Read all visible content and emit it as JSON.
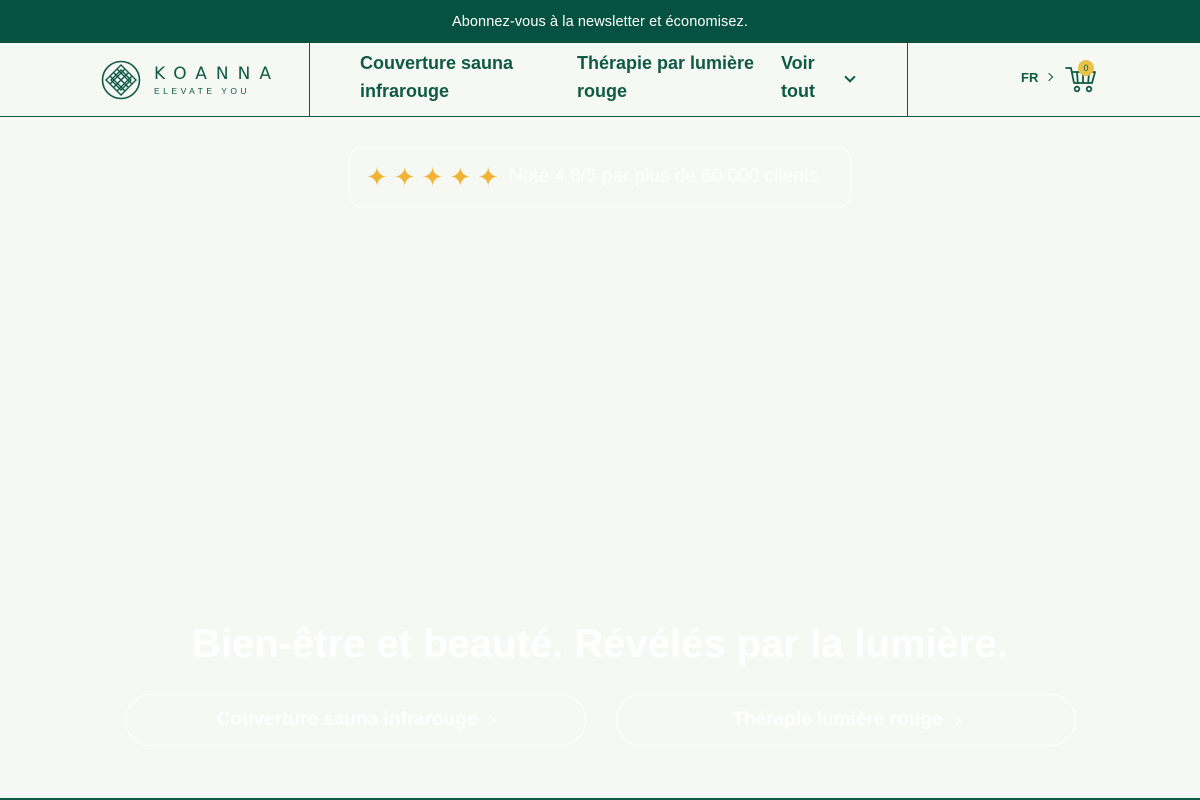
{
  "announcement": {
    "text": "Abonnez-vous à la newsletter et économisez."
  },
  "brand": {
    "name": "KOANNA",
    "tagline": "ELEVATE YOU",
    "logo_icon": "lattice-diamond-icon"
  },
  "nav": {
    "items": [
      {
        "label_line1": "Couverture sauna",
        "label_line2": "infrarouge"
      },
      {
        "label_line1": "Thérapie par lumière",
        "label_line2": "rouge"
      },
      {
        "label_line1": "Voir",
        "label_line2": "tout"
      }
    ]
  },
  "header_tools": {
    "language": "FR",
    "cart_count": "0",
    "cart_icon": "cart-icon"
  },
  "hero": {
    "rating_stars": 5,
    "rating_text": "Noté 4.8/5 par plus de 60 000 clients.",
    "title": "Bien-être et beauté. Révélés par la lumière.",
    "cta_primary": "Couverture sauna infrarouge",
    "cta_secondary": "Thérapie lumière rouge"
  },
  "colors": {
    "brand_green": "#055242",
    "accent_gold": "#f2b232",
    "background": "#f6f8f4"
  }
}
